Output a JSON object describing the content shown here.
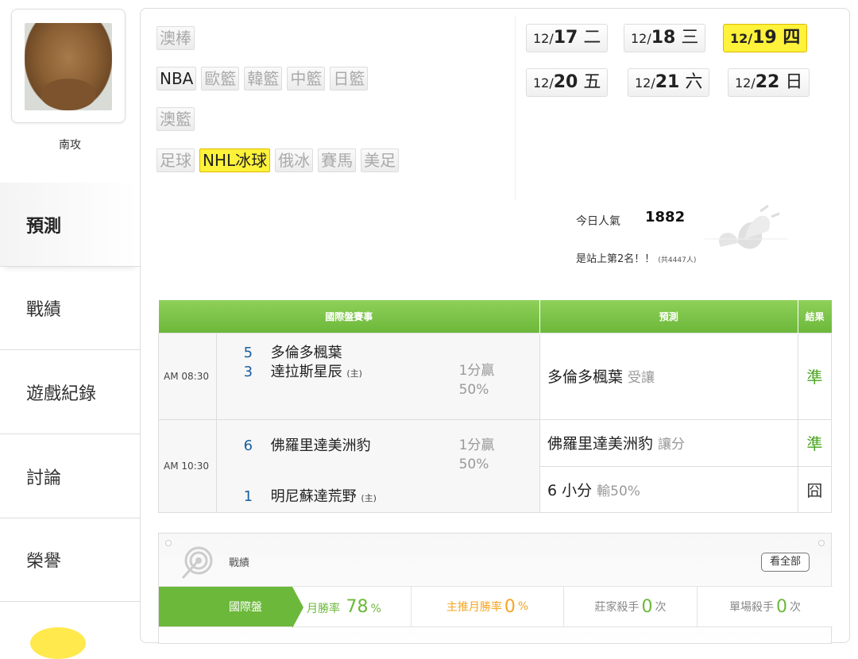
{
  "user": {
    "name": "南攻"
  },
  "nav": [
    {
      "label": "預測",
      "active": true
    },
    {
      "label": "戰績"
    },
    {
      "label": "遊戲紀錄"
    },
    {
      "label": "討論"
    },
    {
      "label": "榮譽"
    }
  ],
  "sports": {
    "row1": [
      "澳棒"
    ],
    "row2": [
      "NBA",
      "歐籃",
      "韓籃",
      "中籃",
      "日籃"
    ],
    "row3": [
      "澳籃"
    ],
    "row4": [
      "足球",
      "NHL冰球",
      "俄冰",
      "賽馬",
      "美足"
    ],
    "active": "NHL冰球"
  },
  "dates": [
    {
      "md": "12/",
      "day": "17",
      "wd": "二"
    },
    {
      "md": "12/",
      "day": "18",
      "wd": "三"
    },
    {
      "md": "12/",
      "day": "19",
      "wd": "四",
      "active": true
    },
    {
      "md": "12/",
      "day": "20",
      "wd": "五"
    },
    {
      "md": "12/",
      "day": "21",
      "wd": "六"
    },
    {
      "md": "12/",
      "day": "22",
      "wd": "日"
    }
  ],
  "popularity": {
    "label": "今日人氣",
    "value": "1882",
    "rank": "是站上第2名！！",
    "total": "(共4447人)"
  },
  "table": {
    "headers": [
      "國際盤賽事",
      "預測",
      "結果"
    ],
    "games": [
      {
        "time": "AM 08:30",
        "away_score": "5",
        "away": "多倫多楓葉",
        "home_score": "3",
        "home": "達拉斯星辰",
        "home_tag": "(主)",
        "odds": "1分贏",
        "odds_pct": "50%",
        "pred_team": "多倫多楓葉",
        "pred_type": "受讓",
        "result": "準"
      },
      {
        "time": "AM 10:30",
        "away_score": "6",
        "away": "佛羅里達美洲豹",
        "home_score": "1",
        "home": "明尼蘇達荒野",
        "home_tag": "(主)",
        "odds": "1分贏",
        "odds_pct": "50%",
        "pred_team": "佛羅里達美洲豹",
        "pred_type": "讓分",
        "result": "準",
        "pred2_main": "6 小分",
        "pred2_sub": "輸50%",
        "result2": "囧"
      }
    ]
  },
  "record": {
    "title": "戰績",
    "see_all": "看全部",
    "tab": "國際盤",
    "month_label": "月勝率",
    "month_value": "78",
    "month_unit": "%",
    "main_label": "主推月勝率",
    "main_value": "0",
    "main_unit": "%",
    "dealer_label": "莊家殺手",
    "dealer_value": "0",
    "dealer_unit": "次",
    "single_label": "單場殺手",
    "single_value": "0",
    "single_unit": "次"
  },
  "colors": {
    "green": "#6cb83a",
    "yellow": "#fff23a",
    "win": "#4aa520",
    "score": "#1a5fa0",
    "orange": "#f5a623"
  }
}
